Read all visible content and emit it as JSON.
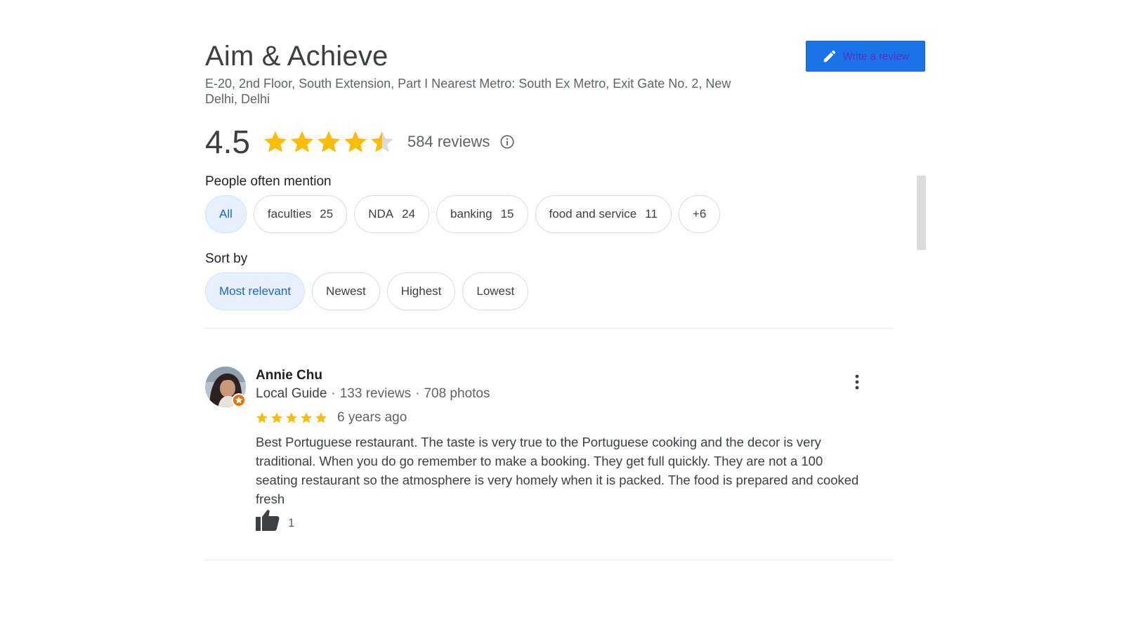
{
  "place": {
    "name": "Aim & Achieve",
    "address": "E-20, 2nd Floor, South Extension, Part I Nearest Metro: South Ex Metro, Exit Gate No. 2, New Delhi, Delhi"
  },
  "write_review": {
    "label": "Write a review",
    "icon": "pencil-icon"
  },
  "rating": {
    "value": "4.5",
    "stars": 4.5,
    "reviews_label": "584 reviews",
    "info_icon": "info-icon"
  },
  "mentions": {
    "label": "People often mention",
    "chips": [
      {
        "label": "All",
        "count": "",
        "selected": true
      },
      {
        "label": "faculties",
        "count": "25",
        "selected": false
      },
      {
        "label": "NDA",
        "count": "24",
        "selected": false
      },
      {
        "label": "banking",
        "count": "15",
        "selected": false
      },
      {
        "label": "food and service",
        "count": "11",
        "selected": false
      },
      {
        "label": "+6",
        "count": "",
        "selected": false
      }
    ]
  },
  "sort": {
    "label": "Sort by",
    "options": [
      {
        "label": "Most relevant",
        "selected": true
      },
      {
        "label": "Newest",
        "selected": false
      },
      {
        "label": "Highest",
        "selected": false
      },
      {
        "label": "Lowest",
        "selected": false
      }
    ]
  },
  "review": {
    "name": "Annie Chu",
    "guide": "Local Guide",
    "reviews": "133 reviews",
    "photos": "708 photos",
    "stars": 5,
    "time": "6 years ago",
    "text": "Best Portuguese restaurant. The taste is very true to the Portuguese cooking and the decor is very traditional. When you do go remember to make a booking. They get full quickly. They are not a 100 seating restaurant so the atmosphere is very homely when it is packed. The food is prepared and cooked fresh",
    "likes": "1"
  },
  "colors": {
    "accent": "#1a73e8",
    "star": "#fbbc04",
    "chip_selected_bg": "#e8f0fe",
    "chip_selected_text": "#1967d2",
    "guide_badge": "#e8710a"
  }
}
